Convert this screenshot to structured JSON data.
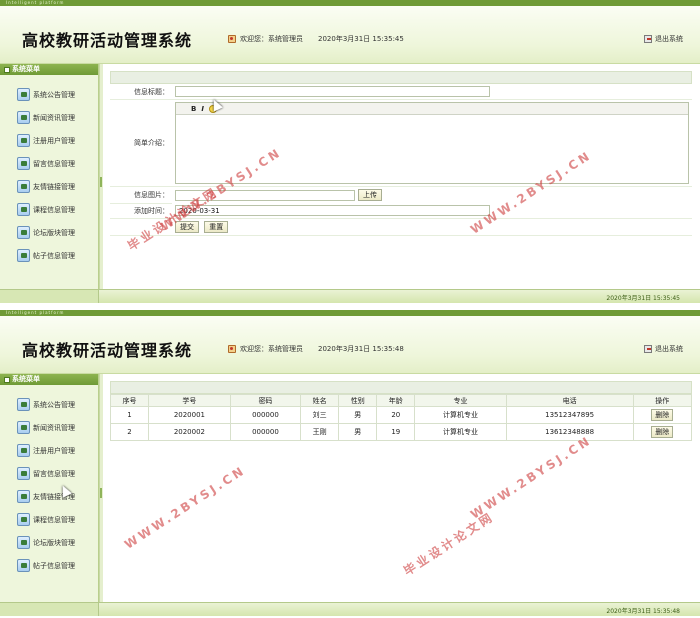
{
  "app": {
    "title": "高校教研活动管理系统",
    "topbar_text": "Intelligent platform",
    "welcome": "欢迎您：系统管理员",
    "logout": "退出系统"
  },
  "sidebar": {
    "title": "系统菜单",
    "items": [
      {
        "label": "系统公告管理"
      },
      {
        "label": "新闻资讯管理"
      },
      {
        "label": "注册用户管理"
      },
      {
        "label": "留言信息管理"
      },
      {
        "label": "友情链接管理"
      },
      {
        "label": "课程信息管理"
      },
      {
        "label": "论坛版块管理"
      },
      {
        "label": "帖子信息管理"
      }
    ]
  },
  "screen1": {
    "header_datetime": "2020年3月31日 15:35:45",
    "footer_datetime": "2020年3月31日 15:35:45",
    "form": {
      "title_label": "信息标题：",
      "title_value": "",
      "intro_label": "简单介绍：",
      "editor_tools": [
        "B",
        "I"
      ],
      "image_label": "信息图片：",
      "upload_button": "上传",
      "time_label": "添加时间：",
      "time_value": "2020-03-31",
      "submit_button": "提交",
      "reset_button": "重置"
    }
  },
  "screen2": {
    "header_datetime": "2020年3月31日 15:35:48",
    "footer_datetime": "2020年3月31日 15:35:48",
    "table": {
      "columns": [
        "序号",
        "学号",
        "密码",
        "姓名",
        "性别",
        "年龄",
        "专业",
        "电话",
        "操作"
      ],
      "rows": [
        [
          "1",
          "2020001",
          "000000",
          "刘三",
          "男",
          "20",
          "计算机专业",
          "13512347895",
          "删除"
        ],
        [
          "2",
          "2020002",
          "000000",
          "王刚",
          "男",
          "19",
          "计算机专业",
          "13612348888",
          "删除"
        ]
      ]
    }
  },
  "watermarks": {
    "site": "WWW.2BYSJ.CN",
    "cn": "毕业设计论文网"
  }
}
